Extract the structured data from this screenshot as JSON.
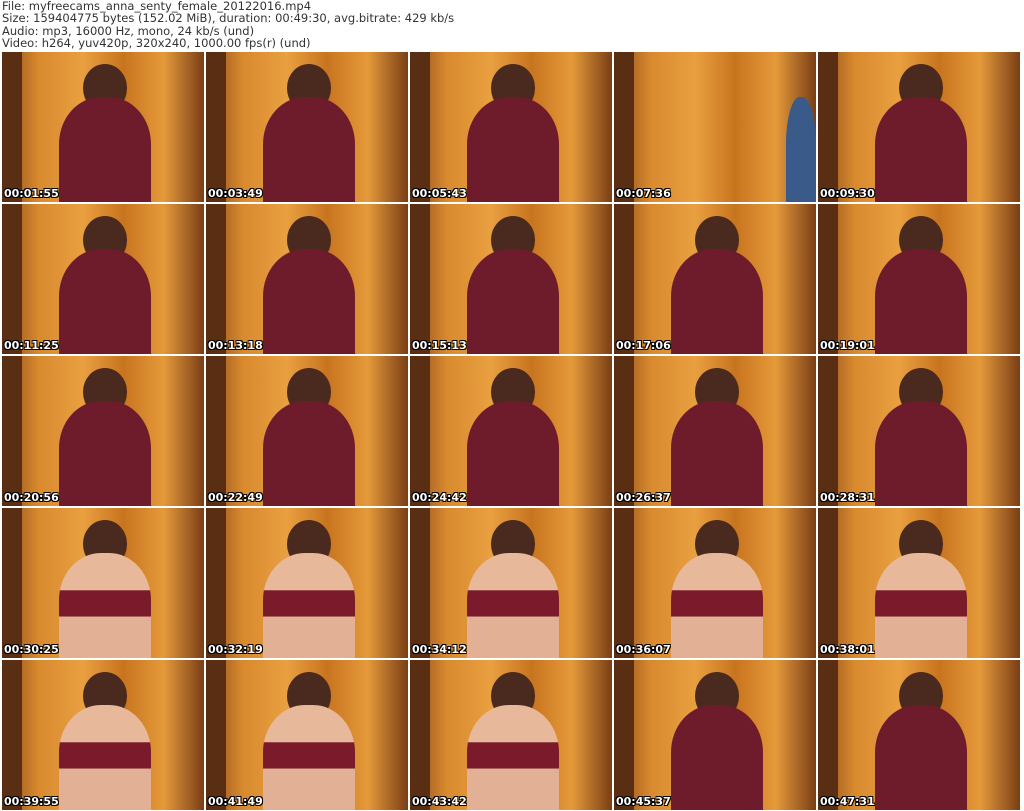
{
  "info": {
    "file": "File: myfreecams_anna_senty_female_20122016.mp4",
    "size": "Size: 159404775 bytes (152.02 MiB), duration: 00:49:30, avg.bitrate: 429 kb/s",
    "audio": "Audio: mp3, 16000 Hz, mono, 24 kb/s (und)",
    "video": "Video: h264, yuv420p, 320x240, 1000.00 fps(r) (und)"
  },
  "thumbnails": [
    {
      "time": "00:01:55",
      "kind": "sweater"
    },
    {
      "time": "00:03:49",
      "kind": "sweater"
    },
    {
      "time": "00:05:43",
      "kind": "sweater"
    },
    {
      "time": "00:07:36",
      "kind": "empty"
    },
    {
      "time": "00:09:30",
      "kind": "sweater"
    },
    {
      "time": "00:11:25",
      "kind": "sweater"
    },
    {
      "time": "00:13:18",
      "kind": "sweater"
    },
    {
      "time": "00:15:13",
      "kind": "sweater"
    },
    {
      "time": "00:17:06",
      "kind": "sweater"
    },
    {
      "time": "00:19:01",
      "kind": "sweater"
    },
    {
      "time": "00:20:56",
      "kind": "sweater"
    },
    {
      "time": "00:22:49",
      "kind": "sweater"
    },
    {
      "time": "00:24:42",
      "kind": "sweater"
    },
    {
      "time": "00:26:37",
      "kind": "sweater"
    },
    {
      "time": "00:28:31",
      "kind": "sweater"
    },
    {
      "time": "00:30:25",
      "kind": "skin"
    },
    {
      "time": "00:32:19",
      "kind": "skin"
    },
    {
      "time": "00:34:12",
      "kind": "skin"
    },
    {
      "time": "00:36:07",
      "kind": "skin"
    },
    {
      "time": "00:38:01",
      "kind": "skin"
    },
    {
      "time": "00:39:55",
      "kind": "skin"
    },
    {
      "time": "00:41:49",
      "kind": "skin"
    },
    {
      "time": "00:43:42",
      "kind": "skin"
    },
    {
      "time": "00:45:37",
      "kind": "sweater"
    },
    {
      "time": "00:47:31",
      "kind": "sweater"
    }
  ]
}
